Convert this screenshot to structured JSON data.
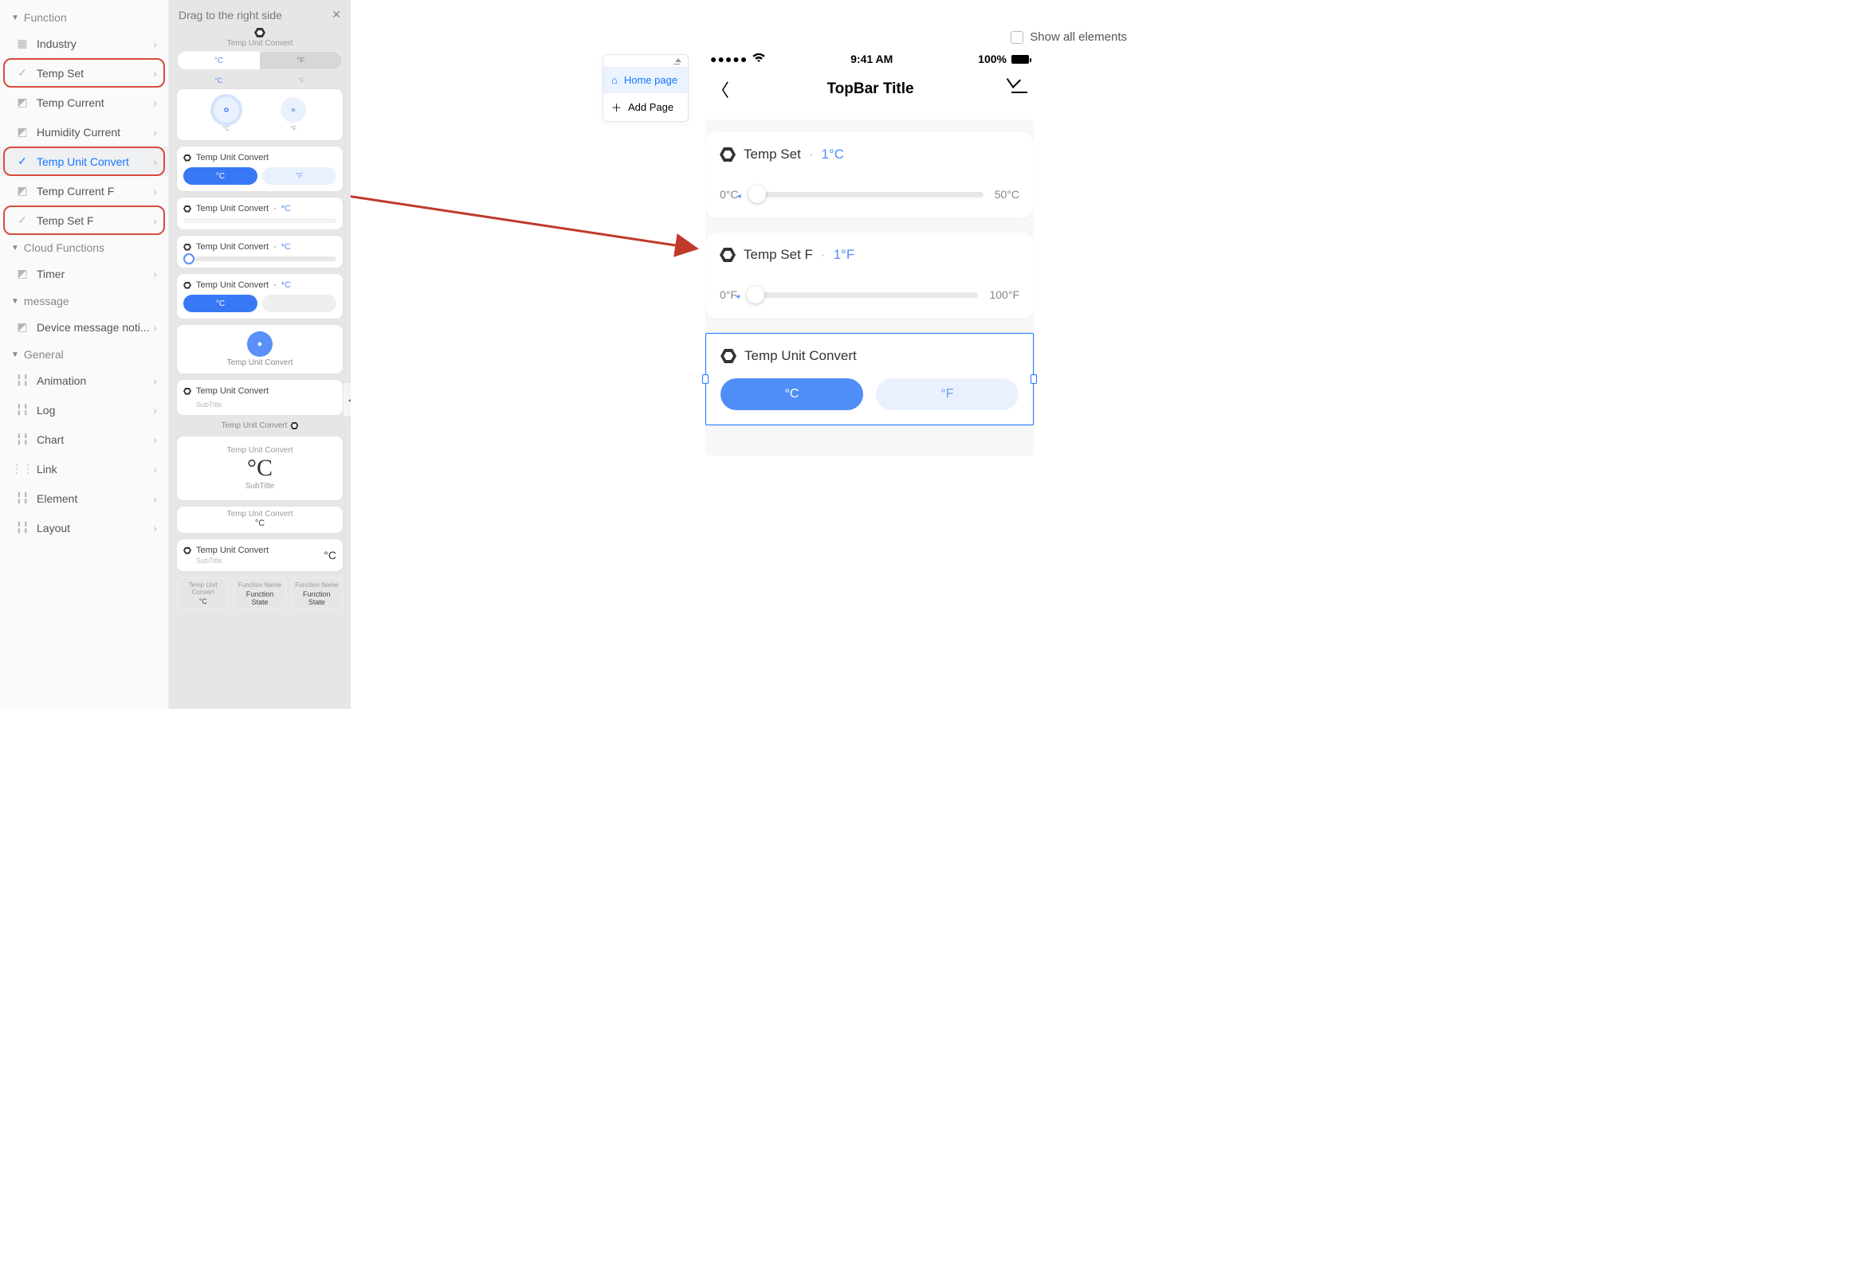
{
  "show_all_label": "Show all elements",
  "sidebar": {
    "g_function": "Function",
    "g_cloud": "Cloud Functions",
    "g_message": "message",
    "g_general": "General",
    "items": [
      {
        "label": "Industry"
      },
      {
        "label": "Temp Set"
      },
      {
        "label": "Temp Current"
      },
      {
        "label": "Humidity Current"
      },
      {
        "label": "Temp Unit Convert"
      },
      {
        "label": "Temp Current F"
      },
      {
        "label": "Temp Set F"
      },
      {
        "label": "Timer"
      },
      {
        "label": "Device message noti..."
      },
      {
        "label": "Animation"
      },
      {
        "label": "Log"
      },
      {
        "label": "Chart"
      },
      {
        "label": "Link"
      },
      {
        "label": "Element"
      },
      {
        "label": "Layout"
      }
    ]
  },
  "mid": {
    "header": "Drag to the right side",
    "tuc": "Temp Unit Convert",
    "sub": "SubTitle",
    "degC": "°C",
    "degF": "°F",
    "degCval": "*C",
    "fname": "Function Name",
    "fstate": "Function State"
  },
  "pages": {
    "home": "Home page",
    "add": "Add Page"
  },
  "phone": {
    "time": "9:41 AM",
    "batt": "100%",
    "topbar_title": "TopBar Title",
    "card1": {
      "title": "Temp Set",
      "val": "1°C",
      "min": "0°C",
      "max": "50°C"
    },
    "card2": {
      "title": "Temp Set F",
      "val": "1°F",
      "min": "0°F",
      "max": "100°F"
    },
    "card3": {
      "title": "Temp Unit Convert",
      "c": "°C",
      "f": "°F"
    }
  }
}
